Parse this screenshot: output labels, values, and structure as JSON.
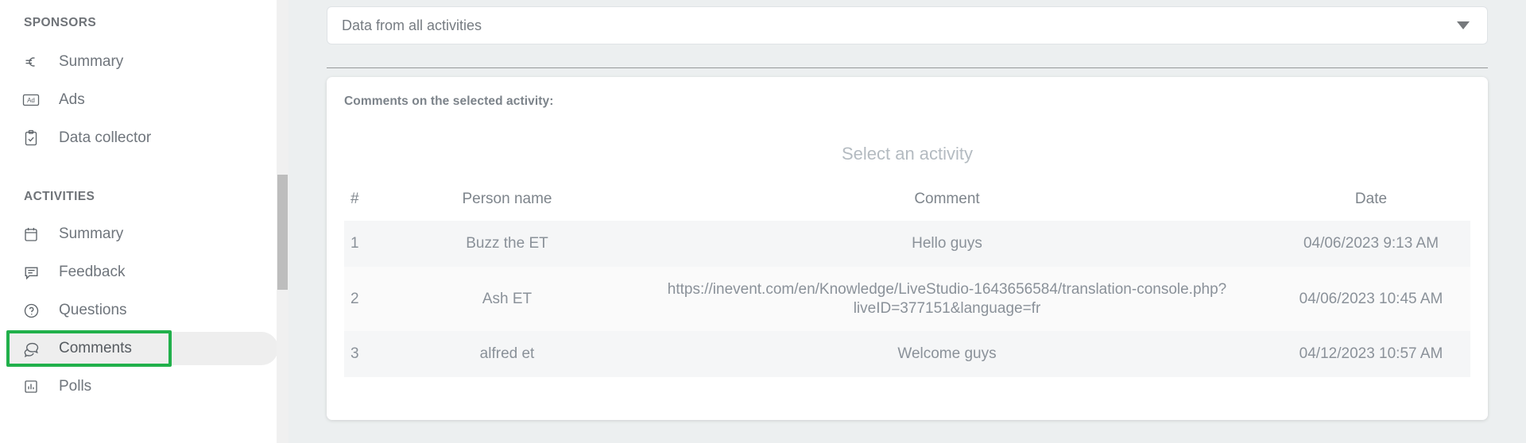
{
  "sidebar": {
    "groups": [
      {
        "title": "SPONSORS",
        "items": [
          {
            "label": "Summary",
            "icon": "euro-icon"
          },
          {
            "label": "Ads",
            "icon": "ad-badge-icon"
          },
          {
            "label": "Data collector",
            "icon": "clipboard-check-icon"
          }
        ]
      },
      {
        "title": "ACTIVITIES",
        "items": [
          {
            "label": "Summary",
            "icon": "calendar-icon"
          },
          {
            "label": "Feedback",
            "icon": "feedback-bubble-icon"
          },
          {
            "label": "Questions",
            "icon": "question-circle-icon"
          },
          {
            "label": "Comments",
            "icon": "comments-bubbles-icon"
          },
          {
            "label": "Polls",
            "icon": "bar-chart-icon"
          }
        ]
      }
    ],
    "active_item": "Comments",
    "highlight_color": "#21b04b"
  },
  "filter": {
    "selected": "Data from all activities",
    "caret_icon": "chevron-down-icon"
  },
  "card": {
    "title": "Comments on the selected activity:",
    "empty_hint": "Select an activity",
    "table": {
      "columns": [
        "#",
        "Person name",
        "Comment",
        "Date"
      ],
      "rows": [
        {
          "num": "1",
          "person": "Buzz the ET",
          "comment": "Hello guys",
          "date": "04/06/2023 9:13 AM"
        },
        {
          "num": "2",
          "person": "Ash ET",
          "comment": "https://inevent.com/en/Knowledge/LiveStudio-1643656584/translation-console.php?liveID=377151&language=fr",
          "date": "04/06/2023 10:45 AM"
        },
        {
          "num": "3",
          "person": "alfred et",
          "comment": "Welcome guys",
          "date": "04/12/2023 10:57 AM"
        }
      ]
    }
  }
}
